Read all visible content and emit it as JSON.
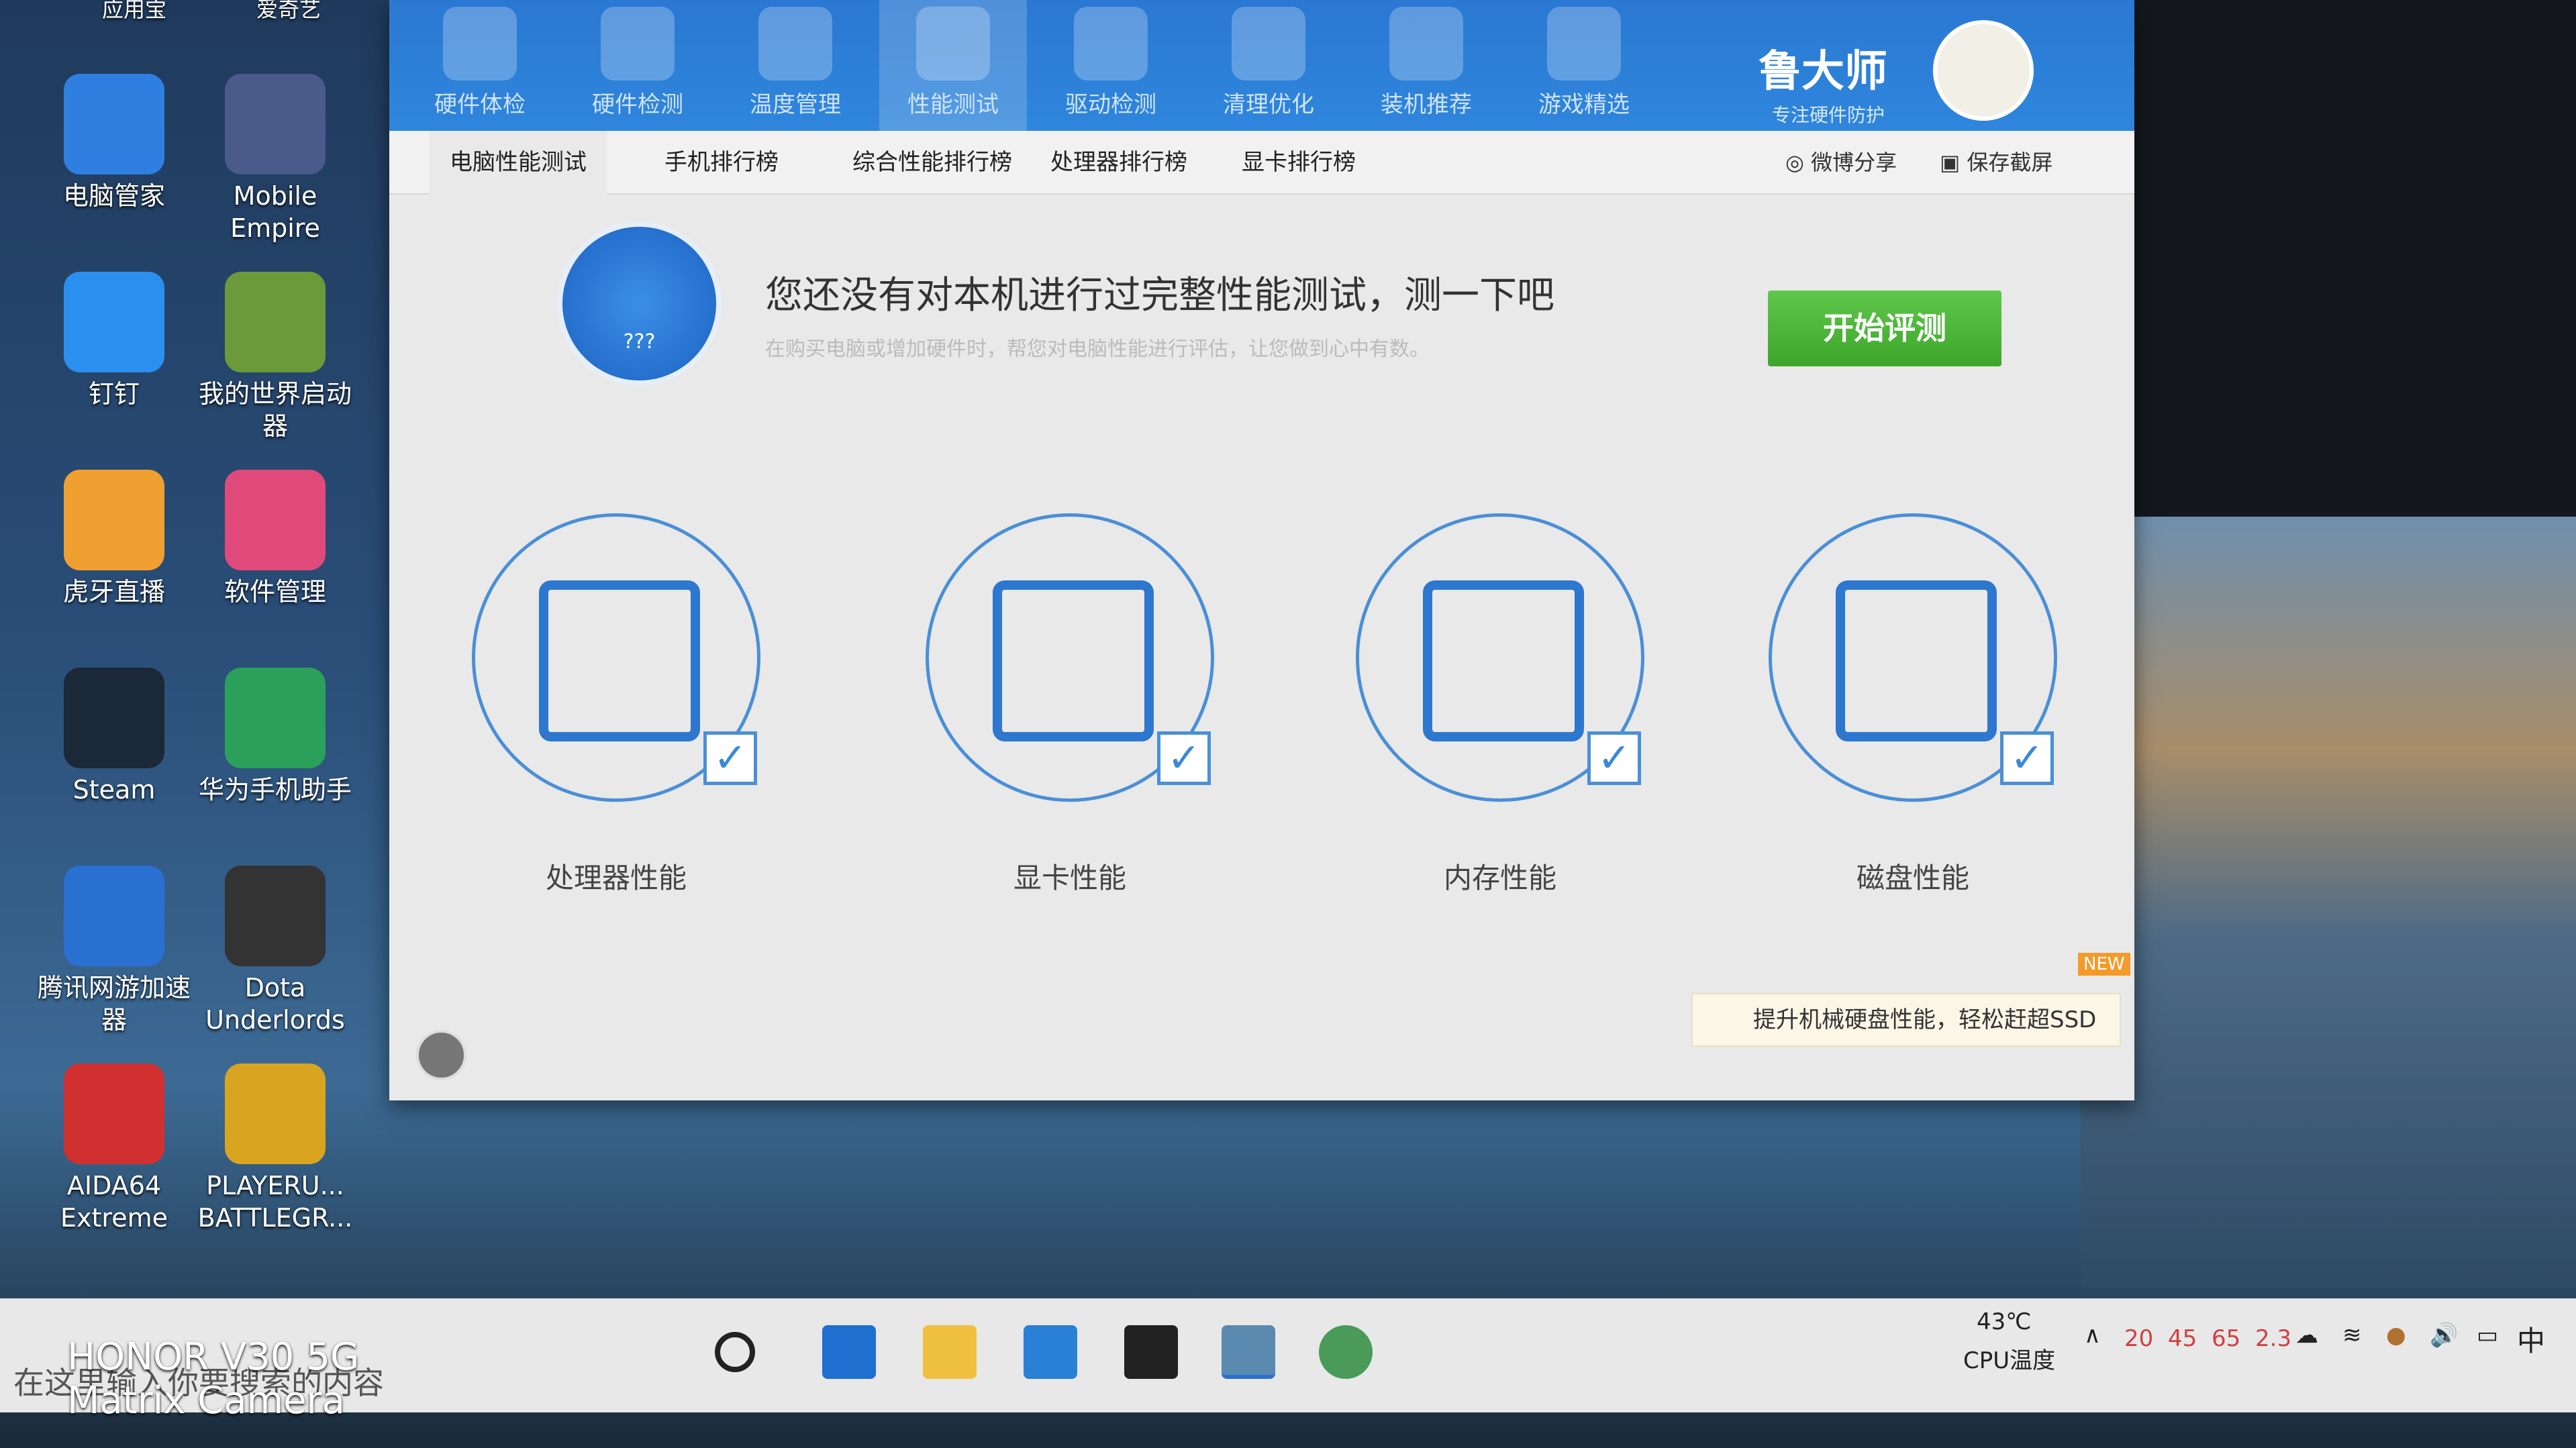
{
  "desktop": {
    "icons": [
      {
        "label": "电脑管家",
        "color": "#2f7fe0"
      },
      {
        "label": "Mobile Empire",
        "color": "#4a5a8a"
      },
      {
        "label": "钉钉",
        "color": "#2b8ff0"
      },
      {
        "label": "我的世界启动器",
        "color": "#6a9a3a"
      },
      {
        "label": "虎牙直播",
        "color": "#f0a030"
      },
      {
        "label": "软件管理",
        "color": "#e04a7a"
      },
      {
        "label": "Steam",
        "color": "#1b2838"
      },
      {
        "label": "华为手机助手",
        "color": "#2aa05a"
      },
      {
        "label": "腾讯网游加速器",
        "color": "#2a70d0"
      },
      {
        "label": "Dota Underlords",
        "color": "#333333"
      },
      {
        "label": "AIDA64 Extreme",
        "color": "#d03030"
      },
      {
        "label": "PLAYERU... BATTLEGR...",
        "color": "#d9a520"
      }
    ],
    "top_cut": [
      "应用宝",
      "爱奇艺"
    ]
  },
  "app": {
    "toolbar": [
      {
        "label": "硬件体检",
        "icon": "monitor-icon"
      },
      {
        "label": "硬件检测",
        "icon": "chip-icon"
      },
      {
        "label": "温度管理",
        "icon": "thermometer-icon"
      },
      {
        "label": "性能测试",
        "icon": "gauge-icon",
        "active": true
      },
      {
        "label": "驱动检测",
        "icon": "driver-icon"
      },
      {
        "label": "清理优化",
        "icon": "broom-icon"
      },
      {
        "label": "装机推荐",
        "icon": "cube-icon"
      },
      {
        "label": "游戏精选",
        "icon": "gamepad-icon"
      }
    ],
    "brand": {
      "name": "鲁大师",
      "slogan": "专注硬件防护"
    },
    "tabs": [
      "电脑性能测试",
      "手机排行榜",
      "综合性能排行榜",
      "处理器排行榜",
      "显卡排行榜"
    ],
    "actions": {
      "share": "微博分享",
      "screenshot": "保存截屏"
    },
    "headline": "您还没有对本机进行过完整性能测试，测一下吧",
    "subline": "在购买电脑或增加硬件时，帮您对电脑性能进行评估，让您做到心中有数。",
    "gauge_text": "???",
    "start_button": "开始评测",
    "accent": "#2f7fd6",
    "button_color": "#4cb43a",
    "cards": [
      {
        "label": "处理器性能",
        "icon": "cpu-monitor-icon",
        "checked": true
      },
      {
        "label": "显卡性能",
        "icon": "cube-icon",
        "checked": true
      },
      {
        "label": "内存性能",
        "icon": "memory-icon",
        "checked": true
      },
      {
        "label": "磁盘性能",
        "icon": "disk-icon",
        "checked": true
      }
    ],
    "promo": {
      "text": "提升机械硬盘性能，轻松赶超SSD",
      "badge": "NEW"
    }
  },
  "taskbar": {
    "search_placeholder": "在这里输入你要搜索的内容",
    "cpu_temp": "43℃",
    "cpu_temp_label": "CPU温度",
    "tray_numbers": [
      "20",
      "45",
      "65",
      "2.3"
    ],
    "ime": "中"
  },
  "watermark": {
    "line1": "HONOR V30 5G",
    "line2": "Matrix Camera"
  }
}
